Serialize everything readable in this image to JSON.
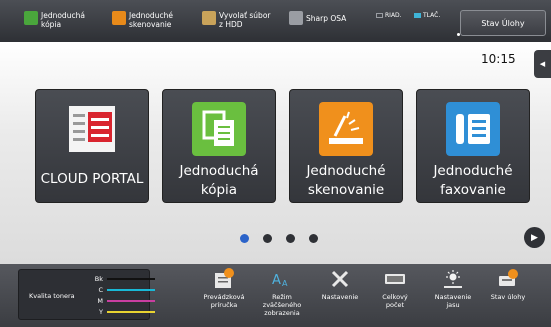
{
  "topbar": {
    "shortcuts": [
      {
        "label": "Jednoduchá\nkópia",
        "icon": "copy-icon",
        "color": "#4aa63c"
      },
      {
        "label": "Jednoduché\nskenovanie",
        "icon": "scan-icon",
        "color": "#e88a1a"
      },
      {
        "label": "Vyvolať súbor\nz HDD",
        "icon": "folder-icon",
        "color": "#c9a35a"
      },
      {
        "label": "Sharp OSA",
        "icon": "osa-icon",
        "color": "#9a9da3"
      }
    ],
    "indicators": [
      {
        "label": "RIAD.",
        "color": "#9a9da3"
      },
      {
        "label": "TLAČ.",
        "color": "#3fb4d8"
      }
    ],
    "status_button": "Stav Úlohy"
  },
  "clock": "10:15",
  "tiles": [
    {
      "label": "CLOUD PORTAL",
      "icon": "cloud-portal-icon"
    },
    {
      "label": "Jednoduchá\nkópia",
      "icon": "copy-icon"
    },
    {
      "label": "Jednoduché\nskenovanie",
      "icon": "scan-icon"
    },
    {
      "label": "Jednoduché\nfaxovanie",
      "icon": "fax-icon"
    }
  ],
  "pager": {
    "count": 4,
    "active": 0
  },
  "toner": {
    "title": "Kvalita tonera",
    "rows": [
      {
        "label": "Bk",
        "color": "#111111"
      },
      {
        "label": "C",
        "color": "#19b8d6"
      },
      {
        "label": "M",
        "color": "#c83ea0"
      },
      {
        "label": "Y",
        "color": "#e8d331"
      }
    ]
  },
  "bottom_items": [
    {
      "label": "Prevádzková\npríručka",
      "icon": "guide-icon"
    },
    {
      "label": "Režim\nzväčšeného\nzobrazenia",
      "icon": "zoom-mode-icon"
    },
    {
      "label": "Nastavenie",
      "icon": "settings-icon"
    },
    {
      "label": "Celkový\npočet",
      "icon": "counter-icon"
    },
    {
      "label": "Nastavenie\njasu",
      "icon": "brightness-icon"
    },
    {
      "label": "Stav úlohy",
      "icon": "job-status-icon"
    }
  ]
}
